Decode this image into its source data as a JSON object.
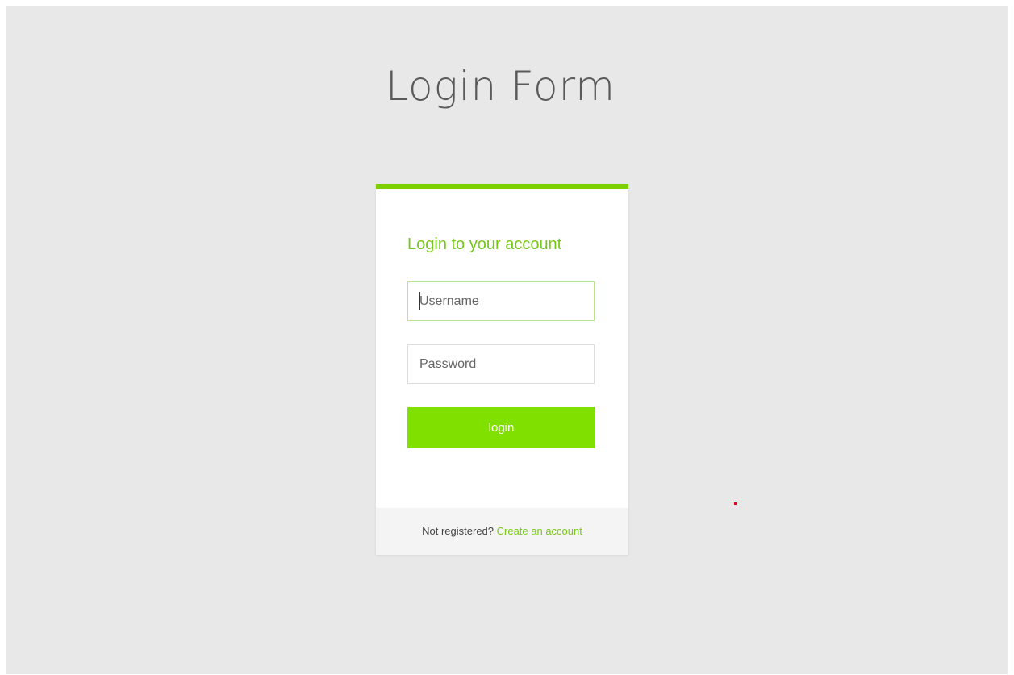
{
  "page": {
    "title": "Login Form"
  },
  "card": {
    "heading": "Login to your account",
    "username": {
      "placeholder": "Username",
      "value": ""
    },
    "password": {
      "placeholder": "Password",
      "value": ""
    },
    "login_label": "login",
    "footer": {
      "prompt": "Not registered?",
      "link_label": "Create an account"
    }
  },
  "colors": {
    "accent": "#7cd000",
    "button": "#80e100",
    "heading": "#78c81b",
    "background": "#e8e8e8",
    "footer_background": "#f4f4f4"
  }
}
